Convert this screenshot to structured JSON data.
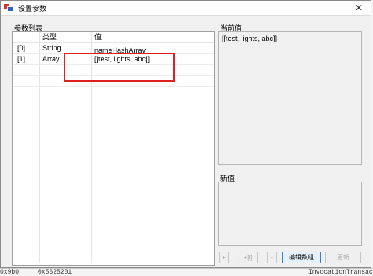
{
  "window": {
    "title": "设置参数",
    "close_glyph": "✕"
  },
  "param_list": {
    "group_title": "参数列表",
    "columns": [
      "",
      "类型",
      "值"
    ],
    "rows": [
      {
        "index": "[0]",
        "type": "String",
        "value": "nameHashArray"
      },
      {
        "index": "[1]",
        "type": "Array",
        "value": "[[test, lights, abc]]"
      }
    ]
  },
  "current_value": {
    "group_title": "当前值",
    "text": "[[test, lights, abc]]"
  },
  "new_value": {
    "group_title": "新值"
  },
  "buttons": {
    "add": "+",
    "add_index": "+[i]",
    "remove": "-",
    "edit_array": "编辑数组",
    "update": "更新"
  },
  "background": {
    "bottom_text_1": "0x9b0",
    "bottom_text_2": "0x5625201",
    "bottom_text_3": "InvocationTransac"
  }
}
